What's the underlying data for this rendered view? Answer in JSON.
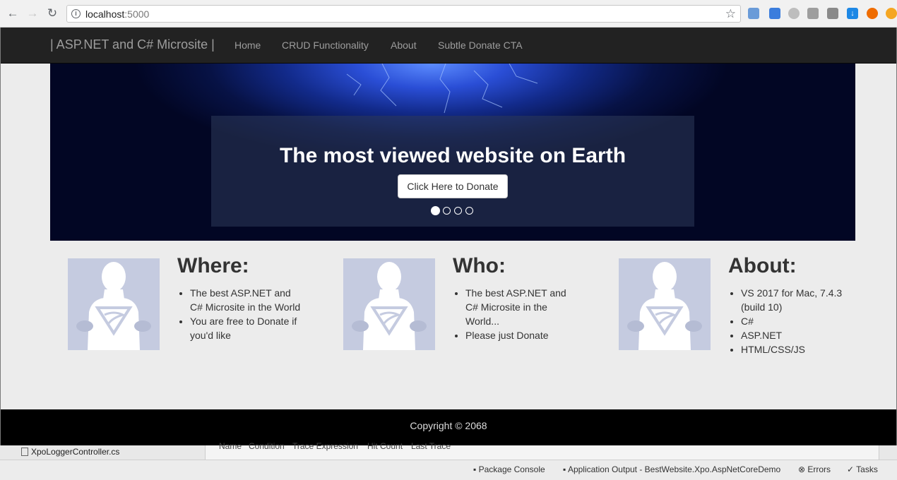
{
  "browser": {
    "url_host": "localhost",
    "url_port": ":5000"
  },
  "navbar": {
    "brand": "| ASP.NET and C# Microsite |",
    "links": [
      "Home",
      "CRUD Functionality",
      "About",
      "Subtle Donate CTA"
    ]
  },
  "carousel": {
    "heading": "The most viewed website on Earth",
    "button": "Click Here to Donate",
    "slide_count": 4,
    "active_slide": 1
  },
  "cards": [
    {
      "title": "Where:",
      "items": [
        "The best ASP.NET and C# Microsite in the World",
        "You are free to Donate if you'd like"
      ]
    },
    {
      "title": "Who:",
      "items": [
        "The best ASP.NET and C# Microsite in the World...",
        "Please just Donate"
      ]
    },
    {
      "title": "About:",
      "items": [
        "VS 2017 for Mac, 7.4.3 (build 10)",
        "C#",
        "ASP.NET",
        "HTML/CSS/JS"
      ]
    }
  ],
  "footer": {
    "copyright": "Copyright © 2068"
  },
  "ide": {
    "file": "XpoLoggerController.cs",
    "columns": [
      "Name",
      "Condition",
      "Trace Expression",
      "Hit Count",
      "Last Trace"
    ],
    "status": [
      "Package Console",
      "Application Output - BestWebsite.Xpo.AspNetCoreDemo",
      "Errors",
      "Tasks"
    ]
  }
}
